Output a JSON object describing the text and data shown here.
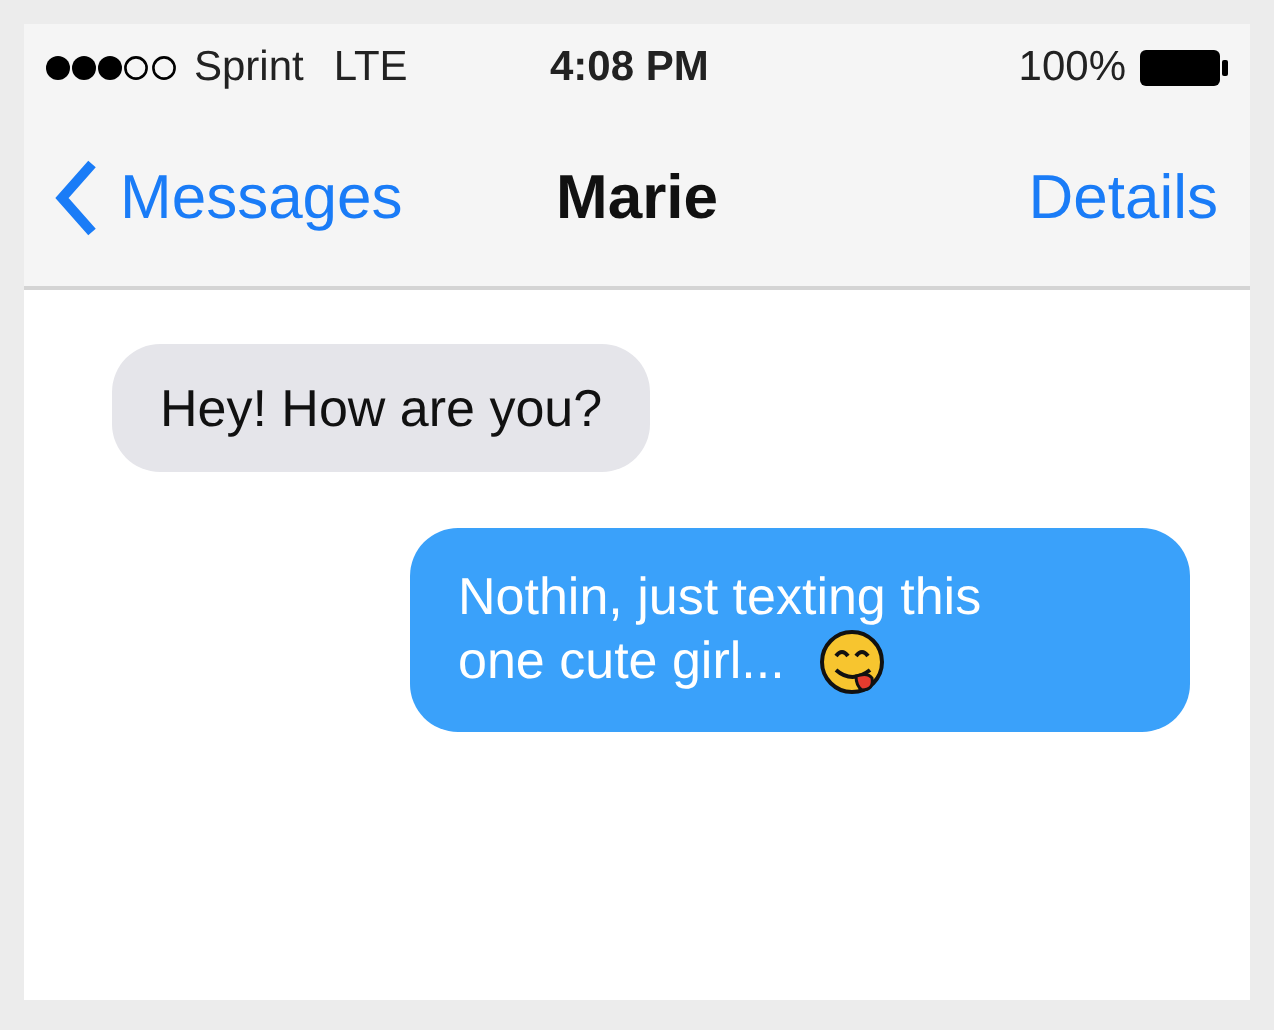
{
  "status_bar": {
    "carrier": "Sprint",
    "network": "LTE",
    "time": "4:08 PM",
    "battery": "100%"
  },
  "nav": {
    "back": "Messages",
    "title": "Marie",
    "action": "Details"
  },
  "messages": [
    {
      "kind": "received",
      "text": "Hey! How are you?",
      "emoji": false
    },
    {
      "kind": "sent",
      "text": "Nothin, just texting this one cute girl...",
      "emoji": true
    }
  ]
}
